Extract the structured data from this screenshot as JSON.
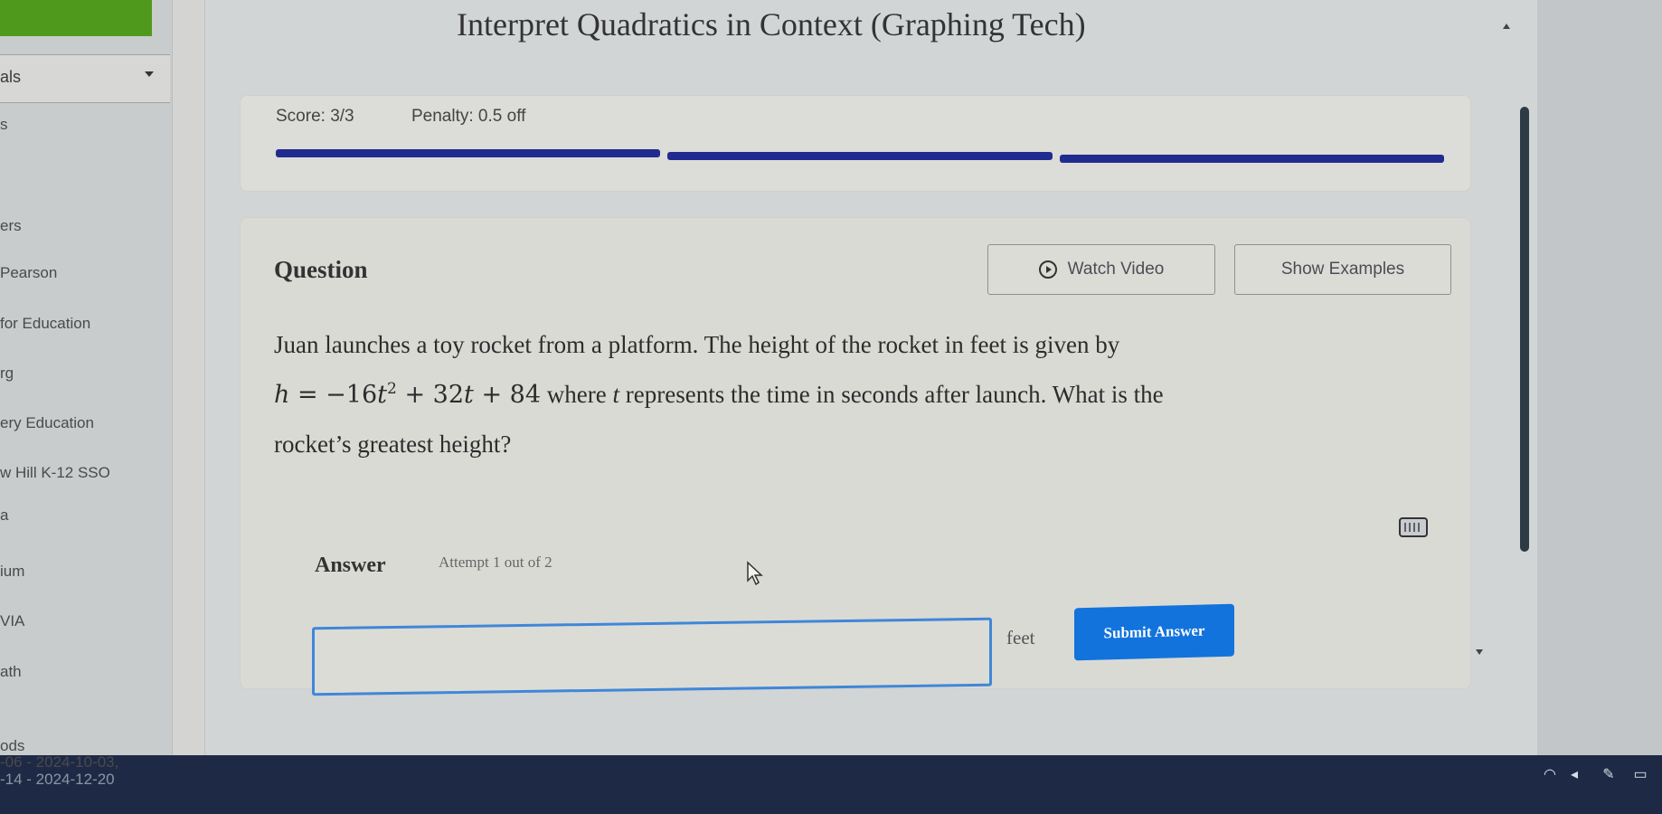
{
  "window": {
    "title": "Interpret Quadratics in Context (Graphing Tech)"
  },
  "sidebar": {
    "select_label": "als",
    "items": [
      {
        "label": "s"
      },
      {
        "label": "ers"
      },
      {
        "label": "Pearson"
      },
      {
        "label": "for Education"
      },
      {
        "label": "rg"
      },
      {
        "label": "ery Education"
      },
      {
        "label": "w Hill K-12 SSO"
      },
      {
        "label": "a"
      },
      {
        "label": "ium"
      },
      {
        "label": "VIA"
      },
      {
        "label": "ath"
      }
    ],
    "footer": {
      "heading": "ods",
      "line1": "-06 - 2024-10-03,",
      "line2": "-14 - 2024-12-20"
    }
  },
  "score": {
    "score_text": "Score: 3/3",
    "penalty_text": "Penalty: 0.5 off",
    "progress_segments_total": 3,
    "progress_segments_filled": 3,
    "progress_color": "#1f2b8f"
  },
  "question": {
    "heading": "Question",
    "watch_video_label": "Watch Video",
    "show_examples_label": "Show Examples",
    "line1": "Juan launches a toy rocket from a platform. The height of the rocket in feet is given by",
    "equation": {
      "lhs": "h",
      "eq": " = −16",
      "var1": "t",
      "exp": "2",
      "mid": " + 32",
      "var2": "t",
      "end": " + 84"
    },
    "line2_rest_a": " where ",
    "line2_var": "t",
    "line2_rest_b": " represents the time in seconds after launch. What is the",
    "line3": "rocket’s greatest height?"
  },
  "answer": {
    "heading": "Answer",
    "attempt_text": "Attempt 1 out of 2",
    "input_value": "",
    "unit": "feet",
    "submit_label": "Submit Answer",
    "accent_color": "#1273dc"
  },
  "icons": {
    "play": "play-circle-icon",
    "keyboard": "keyboard-icon",
    "cursor": "mouse-pointer-icon",
    "tray": [
      "wifi-icon",
      "volume-icon",
      "pen-icon",
      "battery-icon"
    ]
  }
}
